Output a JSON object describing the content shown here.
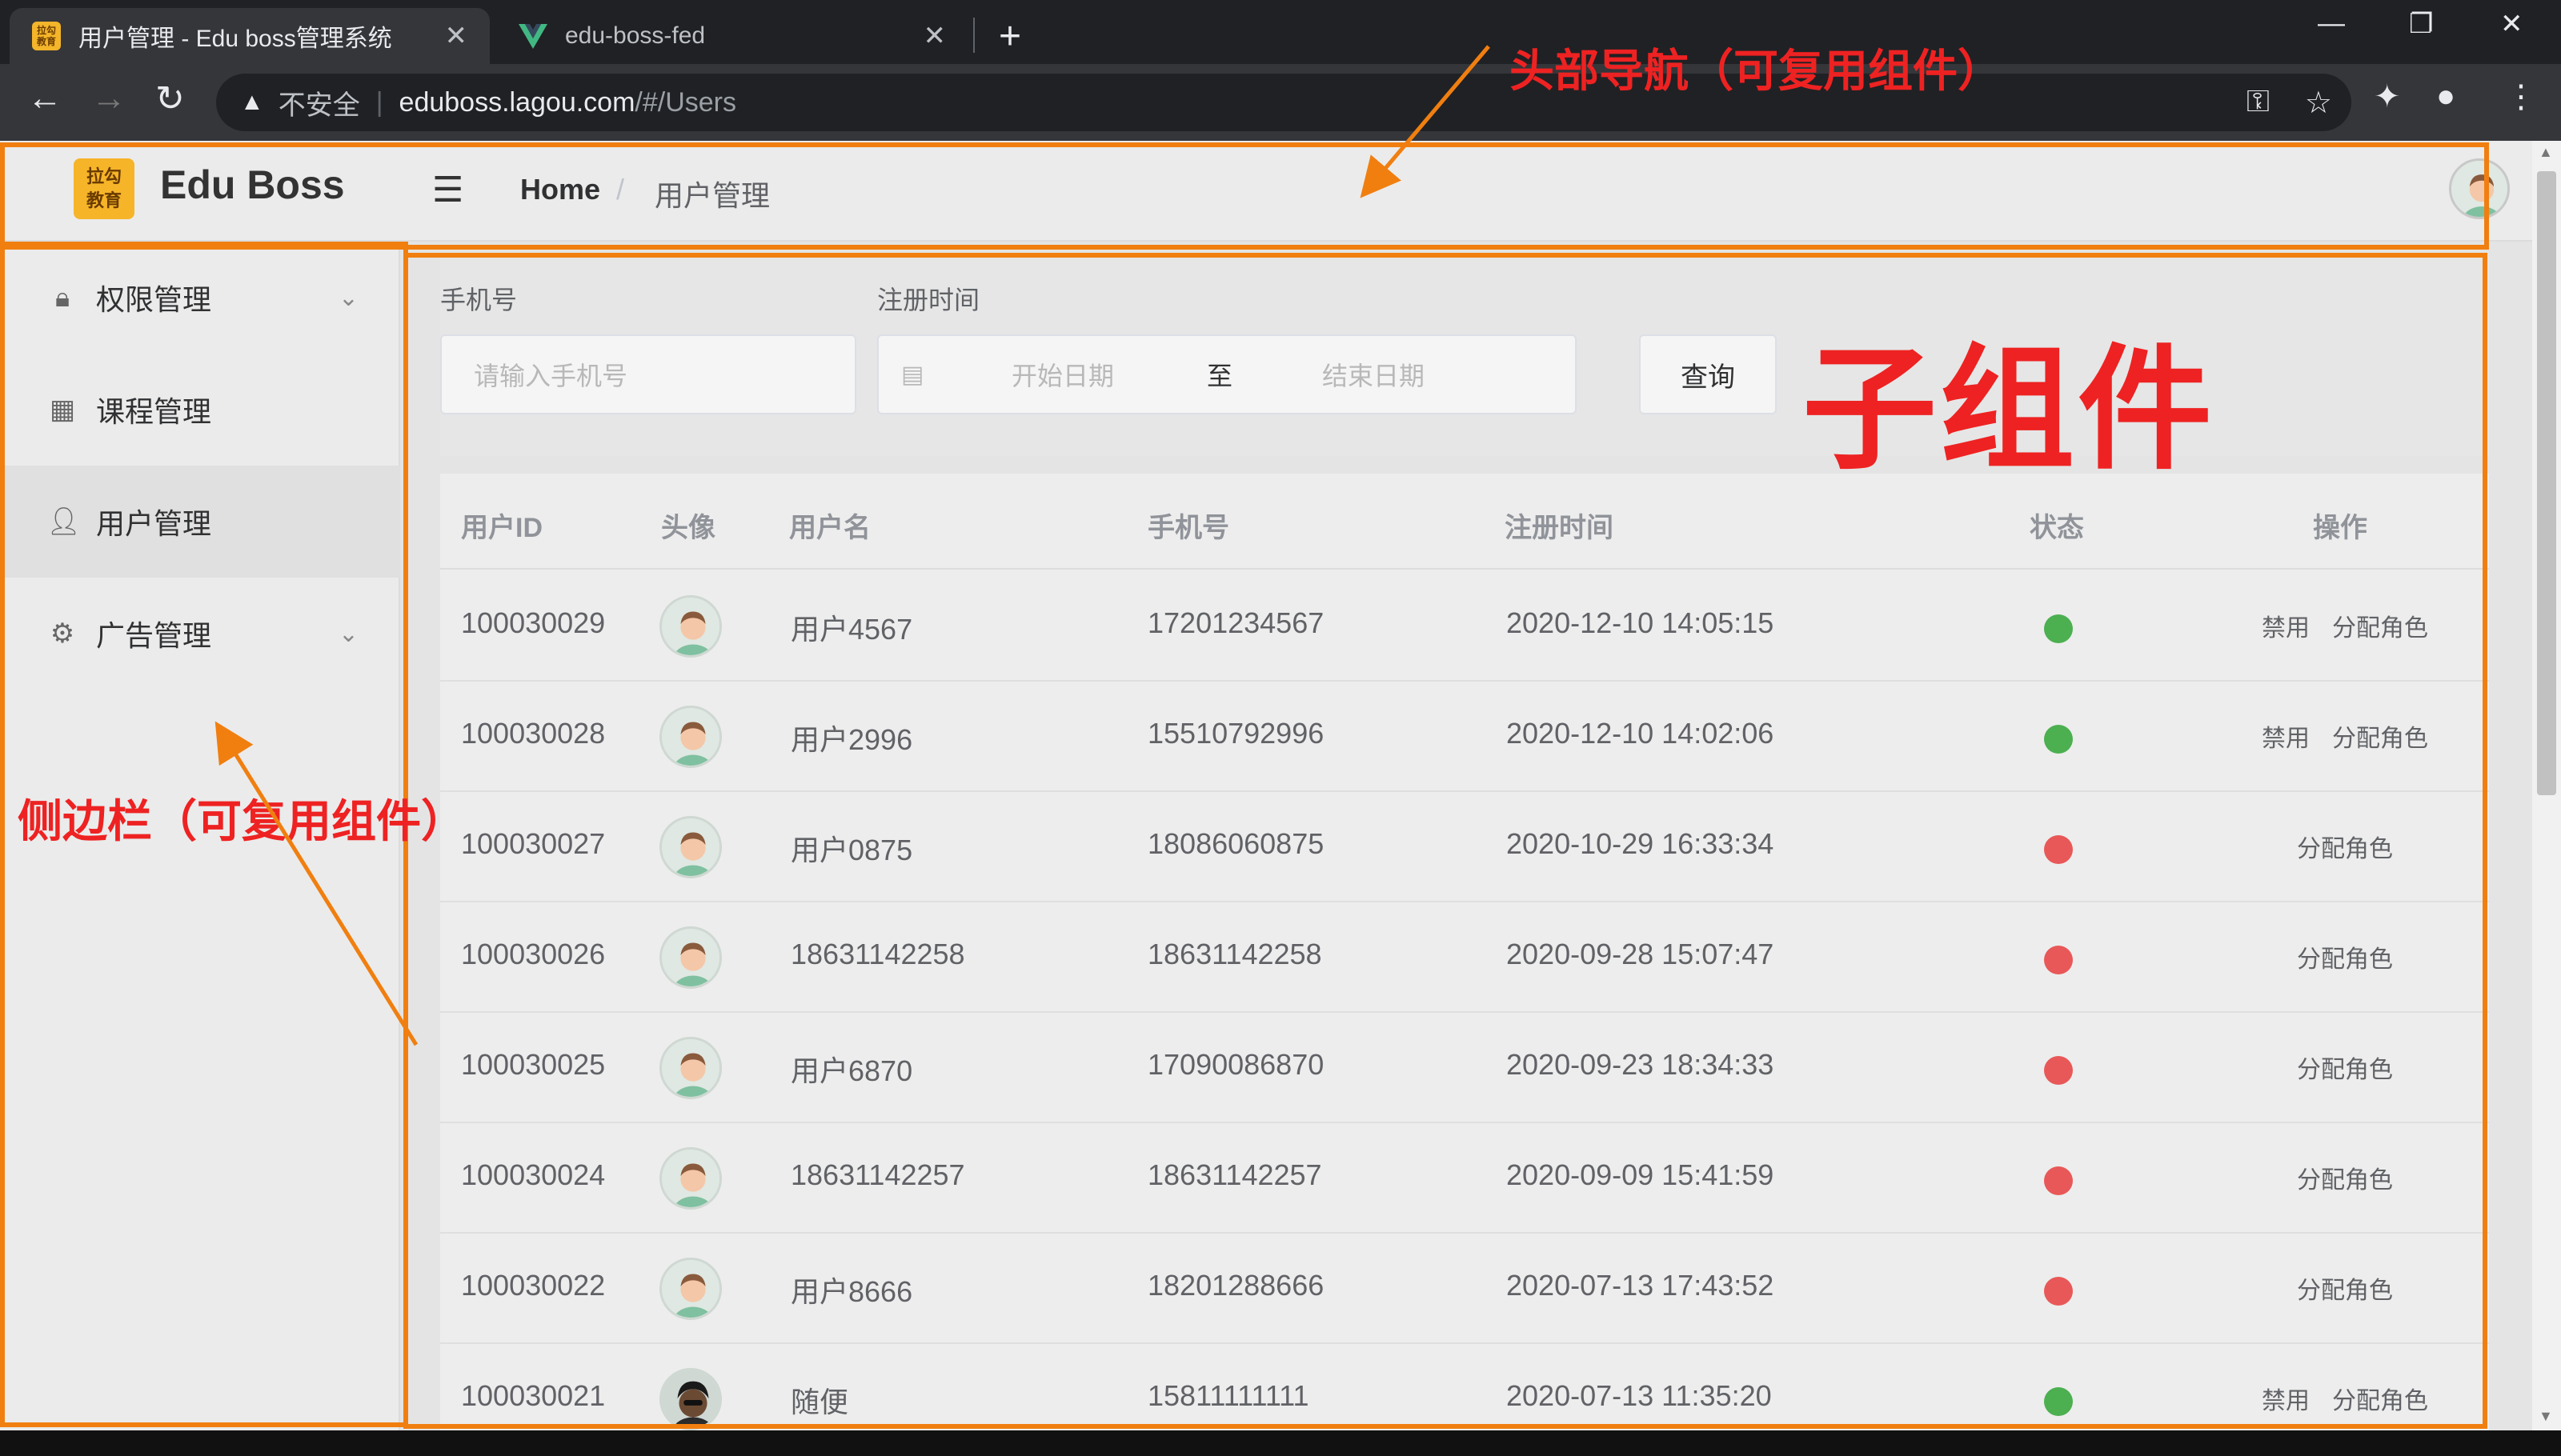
{
  "browser": {
    "tabs": [
      {
        "title": "用户管理 - Edu boss管理系统",
        "active": true
      },
      {
        "title": "edu-boss-fed",
        "active": false
      }
    ],
    "close_glyph": "✕",
    "new_tab_glyph": "+",
    "omnibox": {
      "security": "不安全",
      "host": "eduboss.lagou.com",
      "path": "/#/Users"
    }
  },
  "header": {
    "logo_text": "拉勾教育",
    "brand": "Edu Boss",
    "breadcrumb_home": "Home",
    "breadcrumb_sep": "/",
    "breadcrumb_current": "用户管理"
  },
  "sidebar": {
    "items": [
      {
        "label": "权限管理",
        "icon": "lock-icon",
        "expandable": true,
        "active": false
      },
      {
        "label": "课程管理",
        "icon": "grid-icon",
        "expandable": false,
        "active": false
      },
      {
        "label": "用户管理",
        "icon": "user-icon",
        "expandable": false,
        "active": true
      },
      {
        "label": "广告管理",
        "icon": "gear-icon",
        "expandable": true,
        "active": false
      }
    ]
  },
  "filter": {
    "phone_label": "手机号",
    "phone_placeholder": "请输入手机号",
    "date_label": "注册时间",
    "start_placeholder": "开始日期",
    "date_sep": "至",
    "end_placeholder": "结束日期",
    "query_label": "查询"
  },
  "table": {
    "columns": [
      "用户ID",
      "头像",
      "用户名",
      "手机号",
      "注册时间",
      "状态",
      "操作"
    ],
    "rows": [
      {
        "id": "100030029",
        "name": "用户4567",
        "phone": "17201234567",
        "time": "2020-12-10 14:05:15",
        "status": "enabled",
        "ops": [
          "禁用",
          "分配角色"
        ]
      },
      {
        "id": "100030028",
        "name": "用户2996",
        "phone": "15510792996",
        "time": "2020-12-10 14:02:06",
        "status": "enabled",
        "ops": [
          "禁用",
          "分配角色"
        ]
      },
      {
        "id": "100030027",
        "name": "用户0875",
        "phone": "18086060875",
        "time": "2020-10-29 16:33:34",
        "status": "disabled",
        "ops": [
          "分配角色"
        ]
      },
      {
        "id": "100030026",
        "name": "18631142258",
        "phone": "18631142258",
        "time": "2020-09-28 15:07:47",
        "status": "disabled",
        "ops": [
          "分配角色"
        ]
      },
      {
        "id": "100030025",
        "name": "用户6870",
        "phone": "17090086870",
        "time": "2020-09-23 18:34:33",
        "status": "disabled",
        "ops": [
          "分配角色"
        ]
      },
      {
        "id": "100030024",
        "name": "18631142257",
        "phone": "18631142257",
        "time": "2020-09-09 15:41:59",
        "status": "disabled",
        "ops": [
          "分配角色"
        ]
      },
      {
        "id": "100030022",
        "name": "用户8666",
        "phone": "18201288666",
        "time": "2020-07-13 17:43:52",
        "status": "disabled",
        "ops": [
          "分配角色"
        ]
      },
      {
        "id": "100030021",
        "name": "随便",
        "phone": "15811111111",
        "time": "2020-07-13 11:35:20",
        "status": "enabled",
        "ops": [
          "禁用",
          "分配角色"
        ]
      }
    ]
  },
  "colors": {
    "status_enabled": "#4caf50",
    "status_disabled": "#e85858",
    "annotation_frame": "#f07f10",
    "annotation_text": "#ee2222"
  },
  "annotations": {
    "header": "头部导航（可复用组件）",
    "child": "子组件",
    "sidebar": "侧边栏（可复用组件）"
  }
}
